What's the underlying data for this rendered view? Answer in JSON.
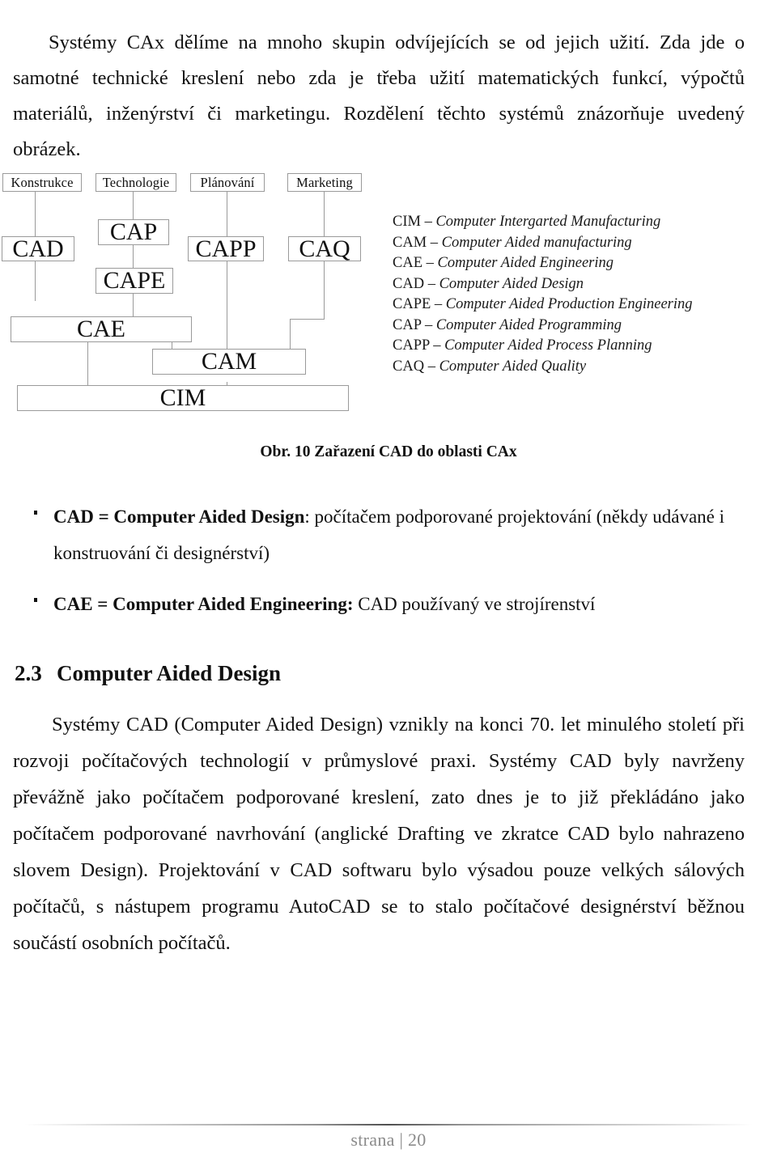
{
  "intro": {
    "indent_marker": "",
    "text": "Systémy CAx dělíme na mnoho skupin odvíjejících se od jejich užití. Zda jde o samotné technické kreslení nebo zda je třeba užití matematických funkcí, výpočtů materiálů, inženýrství či marketingu. Rozdělení těchto systémů znázorňuje uvedený obrázek."
  },
  "diagram": {
    "boxes": {
      "konstrukce": "Konstrukce",
      "technologie": "Technologie",
      "planovani": "Plánování",
      "marketing": "Marketing",
      "cap": "CAP",
      "cad": "CAD",
      "cape": "CAPE",
      "capp": "CAPP",
      "caq": "CAQ",
      "cae": "CAE",
      "cam": "CAM",
      "cim": "CIM"
    }
  },
  "legend": {
    "entries": [
      {
        "abbr": "CIM",
        "sep": " – ",
        "full": "Computer Intergarted Manufacturing"
      },
      {
        "abbr": "CAM",
        "sep": " – ",
        "full": "Computer Aided manufacturing"
      },
      {
        "abbr": "CAE",
        "sep": " – ",
        "full": "Computer Aided Engineering"
      },
      {
        "abbr": "CAD",
        "sep": " – ",
        "full": "Computer Aided Design"
      },
      {
        "abbr": "CAPE",
        "sep": " – ",
        "full": "Computer Aided Production Engineering"
      },
      {
        "abbr": "CAP",
        "sep": " – ",
        "full": "Computer Aided Programming"
      },
      {
        "abbr": "CAPP",
        "sep": " – ",
        "full": "Computer Aided Process Planning"
      },
      {
        "abbr": "CAQ",
        "sep": " – ",
        "full": "Computer Aided Quality"
      }
    ]
  },
  "caption": {
    "text": "Obr. 10 Zařazení CAD do oblasti CAx"
  },
  "bullets": [
    {
      "bold": "CAD = Computer Aided Design",
      "rest": ": počítačem podporované projektování (někdy udávané i konstruování či designérství)"
    },
    {
      "bold": "CAE = Computer Aided Engineering:",
      "rest": " CAD používaný ve strojírenství"
    }
  ],
  "section": {
    "number": "2.3",
    "title": "Computer Aided Design"
  },
  "body_paragraph": {
    "text": "Systémy CAD (Computer Aided Design) vznikly na konci 70. let minulého století při rozvoji počítačových technologií v průmyslové praxi. Systémy CAD byly navrženy převážně jako počítačem podporované kreslení, zato dnes je to již překládáno jako počítačem podporované navrhování (anglické Drafting ve zkratce CAD bylo nahrazeno slovem Design). Projektování v CAD softwaru bylo výsadou pouze velkých sálových počítačů, s nástupem programu AutoCAD se to stalo počítačové designérství běžnou součástí osobních počítačů."
  },
  "footer": {
    "text": "strana | 20"
  }
}
